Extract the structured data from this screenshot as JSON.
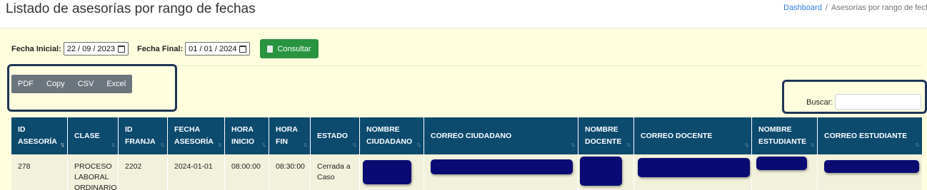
{
  "header": {
    "title": "Listado de asesorías por rango de fechas",
    "breadcrumb": {
      "home": "Dashboard",
      "current": "Asesorías por rango de fechas"
    }
  },
  "filters": {
    "start_label": "Fecha Inicial:",
    "start_value": "22 / 09 / 2023",
    "end_label": "Fecha Final:",
    "end_value": "01 / 01 / 2024",
    "submit_label": "Consultar"
  },
  "export_buttons": [
    "PDF",
    "Copy",
    "CSV",
    "Excel"
  ],
  "search": {
    "label": "Buscar:",
    "value": ""
  },
  "colors": {
    "header_bg": "#0c4a6e",
    "panel_bg": "#ffffe0",
    "button_green": "#28943f",
    "export_gray": "#6c757d",
    "redaction": "#0a0a73"
  },
  "table": {
    "columns": [
      "ID\nASESORÍA",
      "CLASE",
      "ID\nFRANJA",
      "FECHA\nASESORÍA",
      "HORA\nINICIO",
      "HORA\nFIN",
      "ESTADO",
      "NOMBRE\nCIUDADANO",
      "CORREO CIUDADANO",
      "NOMBRE\nDOCENTE",
      "CORREO DOCENTE",
      "NOMBRE\nESTUDIANTE",
      "CORREO ESTUDIANTE"
    ],
    "rows": [
      [
        "278",
        "PROCESO\nLABORAL\nORDINARIO",
        "2202",
        "2024-01-01",
        "08:00:00",
        "08:30:00",
        "Cerrada a\nCaso",
        "",
        "",
        "",
        "",
        "",
        ""
      ]
    ]
  }
}
